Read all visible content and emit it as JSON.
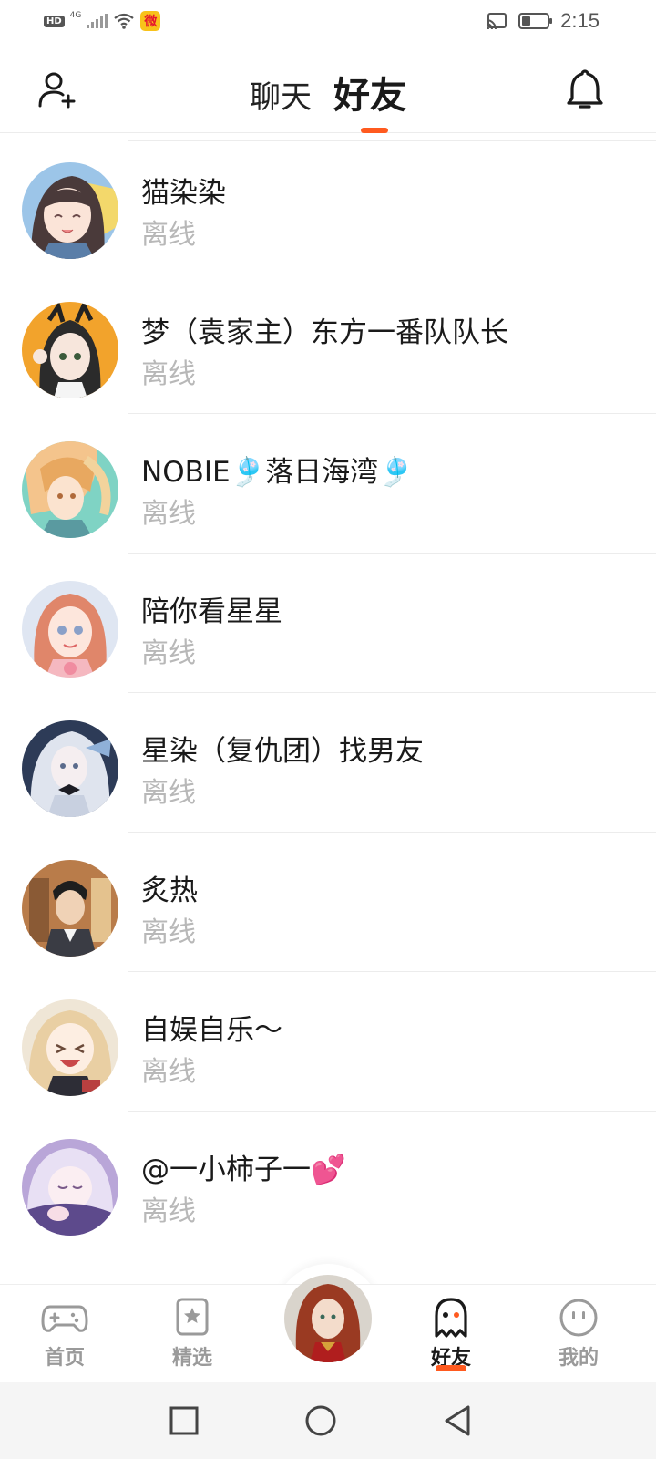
{
  "status_bar": {
    "hd": "HD",
    "network": "4G",
    "time": "2:15",
    "battery_level": 0.35,
    "weibo_glyph": "微"
  },
  "header": {
    "tabs": [
      {
        "label": "聊天",
        "active": false
      },
      {
        "label": "好友",
        "active": true
      }
    ],
    "icons": {
      "left": "add-friend-icon",
      "right": "bell-icon"
    }
  },
  "friends": [
    {
      "name": "猫染染",
      "status": "离线"
    },
    {
      "name": "梦（袁家主）东方一番队队长",
      "status": "离线"
    },
    {
      "name": "NOBIE🎐落日海湾🎐",
      "status": "离线"
    },
    {
      "name": "陪你看星星",
      "status": "离线"
    },
    {
      "name": "星染（复仇团）找男友",
      "status": "离线"
    },
    {
      "name": "炙热",
      "status": "离线"
    },
    {
      "name": "自娱自乐～",
      "status": "离线"
    },
    {
      "name": "@一小柿子一💕",
      "status": "离线"
    }
  ],
  "bottom_nav": [
    {
      "label": "首页",
      "icon": "gamepad-icon",
      "active": false
    },
    {
      "label": "精选",
      "icon": "star-bookmark-icon",
      "active": false
    },
    {
      "label": "好友",
      "icon": "ghost-icon",
      "active": true
    },
    {
      "label": "我的",
      "icon": "face-icon",
      "active": false
    }
  ],
  "system_nav": {
    "icons": [
      "square-icon",
      "circle-icon",
      "back-triangle-icon"
    ]
  },
  "colors": {
    "accent": "#ff5a1f",
    "muted_text": "#b8b8b8",
    "primary_text": "#1a1a1a"
  }
}
